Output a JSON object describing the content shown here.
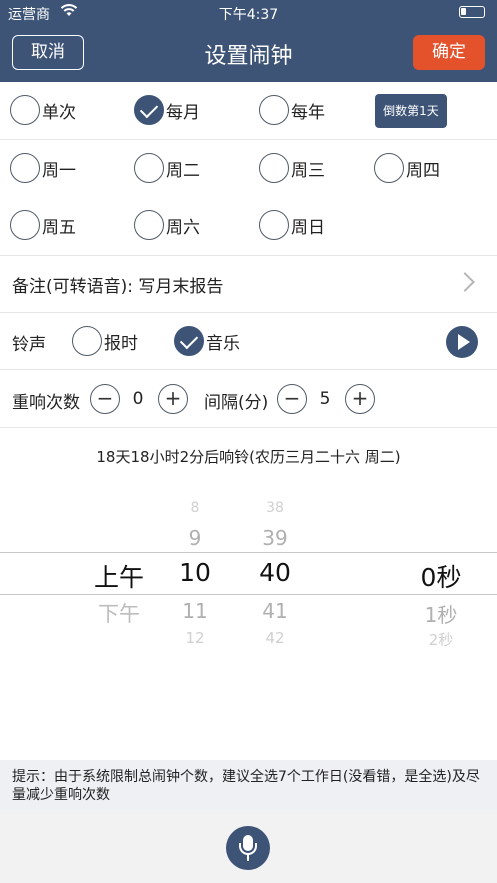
{
  "status": {
    "carrier": "运营商",
    "wifi_icon": "wifi-icon",
    "time": "下午4:37",
    "battery_icon": "battery-icon"
  },
  "nav": {
    "cancel": "取消",
    "title": "设置闹钟",
    "ok": "确定"
  },
  "repeat": {
    "once": "单次",
    "monthly": "每月",
    "yearly": "每年",
    "countdown_badge": "倒数第1天",
    "selected": "每月"
  },
  "weekdays": {
    "mon": "周一",
    "tue": "周二",
    "wed": "周三",
    "thu": "周四",
    "fri": "周五",
    "sat": "周六",
    "sun": "周日"
  },
  "note": {
    "label": "备注(可转语音): 写月末报告"
  },
  "ringtone": {
    "label": "铃声",
    "chime": "报时",
    "music": "音乐",
    "selected": "音乐"
  },
  "repeat_ring": {
    "label": "重响次数",
    "count": "0",
    "interval_label": "间隔(分)",
    "interval": "5",
    "minus": "−",
    "plus": "+"
  },
  "countdown_text": "18天18小时2分后响铃(农历三月二十六 周二)",
  "picker": {
    "ampm": {
      "selected": "上午",
      "next": "下午"
    },
    "hour": {
      "prev2": "8",
      "prev1": "9",
      "selected": "10",
      "next1": "11",
      "next2": "12"
    },
    "minute": {
      "prev2": "38",
      "prev1": "39",
      "selected": "40",
      "next1": "41",
      "next2": "42"
    },
    "second": {
      "selected": "0秒",
      "next1": "1秒",
      "next2": "2秒"
    }
  },
  "tip": "提示：由于系统限制总闹钟个数，建议全选7个工作日(没看错，是全选)及尽量减少重响次数",
  "colors": {
    "primary": "#3d5477",
    "confirm": "#e4522c"
  }
}
